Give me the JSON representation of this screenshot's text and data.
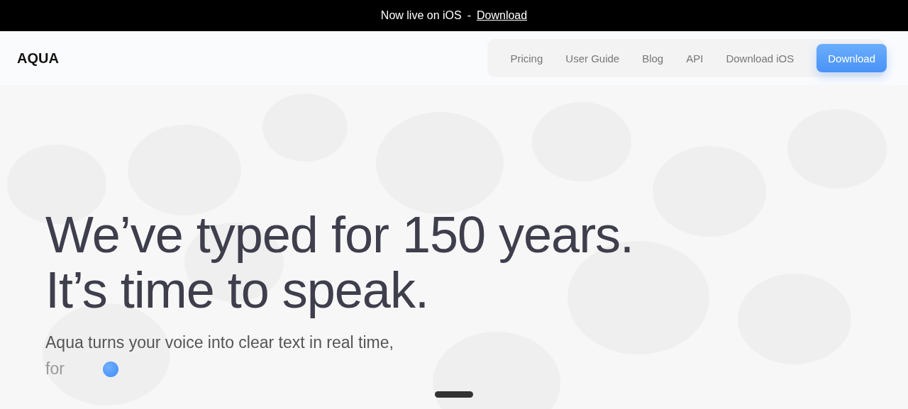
{
  "banner": {
    "text": "Now live on iOS",
    "separator": "-",
    "link": "Download"
  },
  "header": {
    "logo": "AQUA",
    "nav": [
      "Pricing",
      "User Guide",
      "Blog",
      "API",
      "Download iOS"
    ],
    "cta": "Download"
  },
  "hero": {
    "headline": [
      "We’ve typed for 150 years.",
      "It’s time to speak."
    ],
    "subtitle": "Aqua turns your voice into clear text in real time,",
    "rotating_text": "for"
  }
}
